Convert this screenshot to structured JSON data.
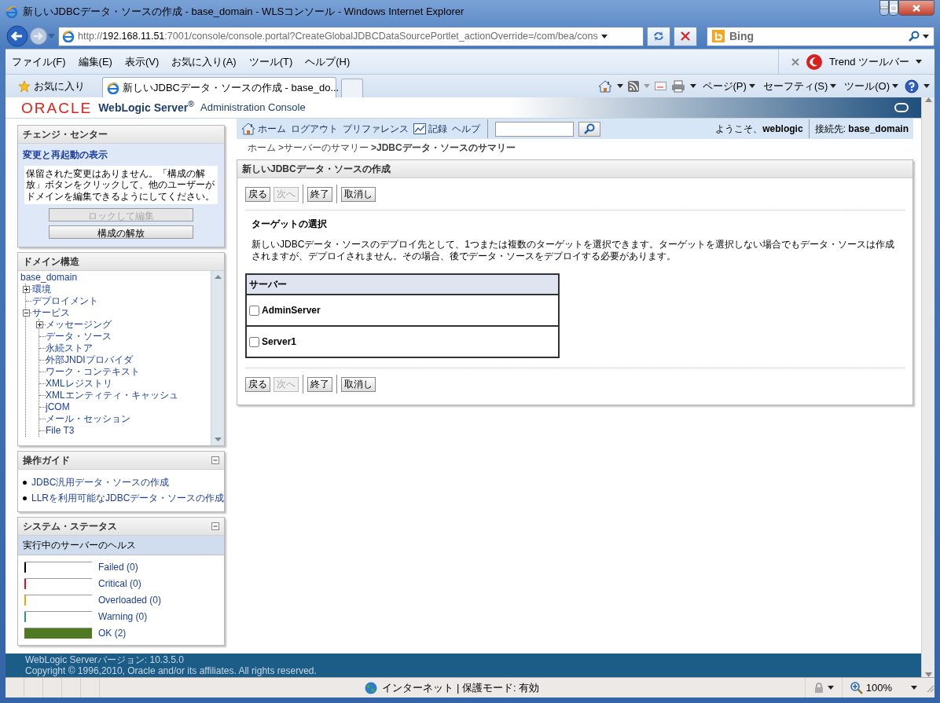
{
  "window": {
    "title": "新しいJDBCデータ・ソースの作成 - base_domain - WLSコンソール - Windows Internet Explorer"
  },
  "address_bar": {
    "url": "http://**192.168.11.51**:7001/console/console.portal?CreateGlobalJDBCDataSourcePortlet_actionOverride=/com/bea/cons"
  },
  "search_box": {
    "placeholder": "Bing"
  },
  "menu": [
    "ファイル(F)",
    "編集(E)",
    "表示(V)",
    "お気に入り(A)",
    "ツール(T)",
    "ヘルプ(H)"
  ],
  "trend_toolbar": {
    "label": "Trend ツールバー"
  },
  "favorites": {
    "label": "お気に入り"
  },
  "tabs": [
    {
      "label": "新しいJDBCデータ・ソースの作成 - base_do...",
      "selected": true
    }
  ],
  "command_bar": [
    "ページ(P)",
    "セーフティ(S)",
    "ツール(O)"
  ],
  "console": {
    "logo": "ORACLE",
    "product": "WebLogic Server$^{®}$",
    "subtitle": "Administration Console",
    "change_center": {
      "title": "チェンジ・センター",
      "link": "変更と再起動の表示",
      "message": "保留された変更はありません。「構成の解放」ボタンをクリックして、他のユーザーがドメインを編集できるようにしてください。",
      "buttons": [
        {
          "label": "ロックして編集",
          "disabled": true
        },
        {
          "label": "構成の解放",
          "disabled": false
        }
      ]
    },
    "domain_structure": {
      "title": "ドメイン構造",
      "root": "base_domain",
      "tree": [
        {
          "label": "環境",
          "kind": "folder",
          "expanded": false
        },
        {
          "label": "デプロイメント",
          "kind": "leaf"
        },
        {
          "label": "サービス",
          "kind": "folder",
          "expanded": true,
          "children": [
            {
              "label": "メッセージング",
              "kind": "folder",
              "expanded": false
            },
            {
              "label": "データ・ソース",
              "kind": "leaf"
            },
            {
              "label": "永続ストア",
              "kind": "leaf"
            },
            {
              "label": "外部JNDIプロバイダ",
              "kind": "leaf"
            },
            {
              "label": "ワーク・コンテキスト",
              "kind": "leaf"
            },
            {
              "label": "XMLレジストリ",
              "kind": "leaf"
            },
            {
              "label": "XMLエンティティ・キャッシュ",
              "kind": "leaf"
            },
            {
              "label": "jCOM",
              "kind": "leaf"
            },
            {
              "label": "メール・セッション",
              "kind": "leaf"
            },
            {
              "label": "File T3",
              "kind": "leaf"
            }
          ]
        }
      ]
    },
    "how_do_i": {
      "title": "操作ガイド",
      "links": [
        "JDBC汎用データ・ソースの作成",
        "LLRを利用可能なJDBCデータ・ソースの作成"
      ]
    },
    "system_status": {
      "title": "システム・ステータス",
      "subtitle": "実行中のサーバーのヘルス",
      "rows": [
        {
          "label": "Failed (0)",
          "color": "#000000",
          "level": 0
        },
        {
          "label": "Critical (0)",
          "color": "#e01010",
          "level": 0
        },
        {
          "label": "Overloaded (0)",
          "color": "#f0a800",
          "level": 0
        },
        {
          "label": "Warning (0)",
          "color": "#2a8fa8",
          "level": 0
        },
        {
          "label": "OK (2)",
          "color": "#4f7a21",
          "level": 1
        }
      ]
    },
    "toolbar": {
      "links": [
        {
          "label": "ホーム",
          "kind": "home"
        },
        {
          "label": "ログアウト",
          "kind": "text"
        },
        {
          "label": "プリファレンス",
          "kind": "text"
        },
        {
          "label": "記録",
          "kind": "record"
        },
        {
          "label": "ヘルプ",
          "kind": "text"
        }
      ],
      "welcome": "ようこそ、**weblogic**",
      "connected": "接続先: **base_domain**"
    },
    "breadcrumb": [
      {
        "label": "ホーム",
        "current": false
      },
      {
        "label": ">サーバーのサマリー",
        "current": false
      },
      {
        "label": ">JDBCデータ・ソースのサマリー",
        "current": true
      }
    ],
    "panel": {
      "title": "新しいJDBCデータ・ソースの作成",
      "buttons_top": [
        {
          "label": "戻る",
          "disabled": false,
          "separator_before": false
        },
        {
          "label": "次へ",
          "disabled": true,
          "separator_before": false
        },
        {
          "label": "終了",
          "disabled": false,
          "separator_before": true
        },
        {
          "label": "取消し",
          "disabled": false,
          "separator_before": true
        }
      ],
      "heading": "ターゲットの選択",
      "description": "新しいJDBCデータ・ソースのデプロイ先として、1つまたは複数のターゲットを選択できます。ターゲットを選択しない場合でもデータ・ソースは作成されますが、デプロイされません。その場合、後でデータ・ソースをデプロイする必要があります。",
      "table": {
        "columns": [
          "サーバー"
        ],
        "rows": [
          {
            "name": "AdminServer",
            "checked": false
          },
          {
            "name": "Server1",
            "checked": false
          }
        ]
      },
      "buttons_bottom": [
        {
          "label": "戻る",
          "disabled": false,
          "separator_before": false
        },
        {
          "label": "次へ",
          "disabled": true,
          "separator_before": false
        },
        {
          "label": "終了",
          "disabled": false,
          "separator_before": true
        },
        {
          "label": "取消し",
          "disabled": false,
          "separator_before": true
        }
      ]
    },
    "footer": {
      "version": "WebLogic Serverバージョン: 10.3.5.0",
      "copyright": "Copyright © 1996,2010, Oracle and/or its affiliates. All rights reserved."
    }
  },
  "status_bar": {
    "zone": "インターネット | 保護モード: 有効",
    "zoom": "100%"
  }
}
